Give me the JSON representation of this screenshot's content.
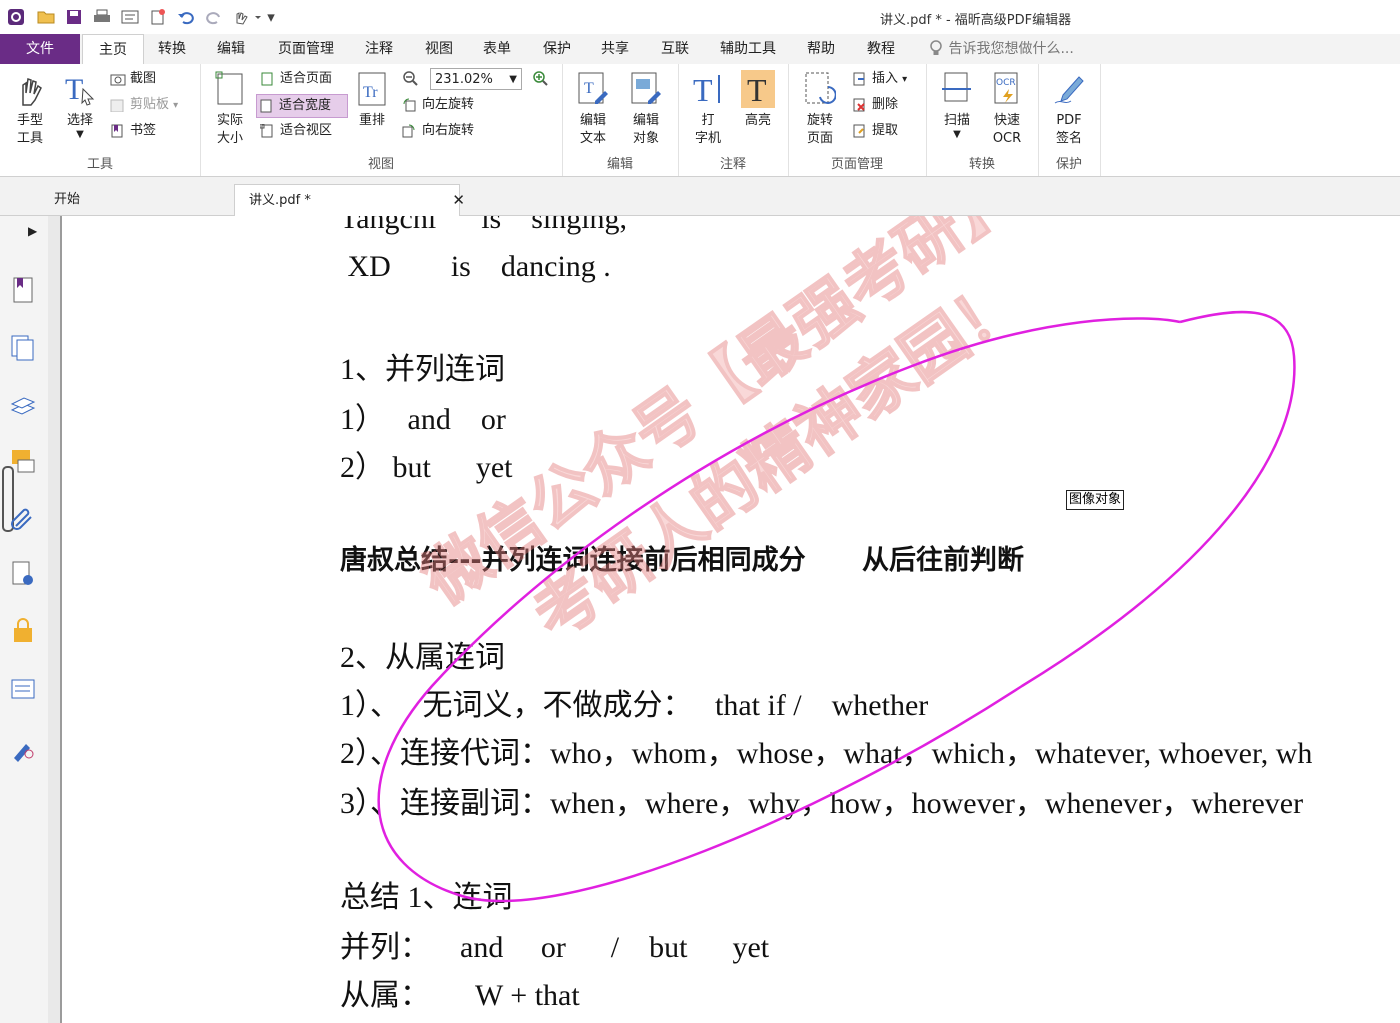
{
  "window": {
    "title": "讲义.pdf * - 福昕高级PDF编辑器"
  },
  "menu": {
    "file": "文件",
    "tabs": [
      "主页",
      "转换",
      "编辑",
      "页面管理",
      "注释",
      "视图",
      "表单",
      "保护",
      "共享",
      "互联",
      "辅助工具",
      "帮助",
      "教程"
    ],
    "tell_me": "告诉我您想做什么..."
  },
  "ribbon": {
    "tools": {
      "hand": "手型\n工具",
      "select": "选择",
      "screenshot": "截图",
      "clipboard": "剪贴板",
      "bookmark": "书签",
      "label": "工具"
    },
    "view": {
      "actual": "实际\n大小",
      "fit_page": "适合页面",
      "fit_width": "适合宽度",
      "fit_area": "适合视区",
      "reflow": "重排",
      "zoom": "231.02%",
      "rotate_left": "向左旋转",
      "rotate_right": "向右旋转",
      "label": "视图"
    },
    "edit": {
      "edit_text": "编辑\n文本",
      "edit_object": "编辑\n对象",
      "label": "编辑"
    },
    "comment": {
      "typewriter": "打\n字机",
      "highlight": "高亮",
      "label": "注释"
    },
    "pages": {
      "rotate": "旋转\n页面",
      "insert": "插入",
      "delete": "删除",
      "extract": "提取",
      "label": "页面管理"
    },
    "convert": {
      "scan": "扫描",
      "ocr": "快速\nOCR",
      "label": "转换"
    },
    "protect": {
      "sign": "PDF\n签名",
      "label": "保护"
    }
  },
  "doctabs": {
    "start": "开始",
    "file": "讲义.pdf *"
  },
  "document": {
    "lines": [
      "Tangchi      is    singing,",
      " XD        is    dancing .",
      "1、并列连词",
      "1）   and    or",
      "2） but      yet",
      "唐叔总结---并列连词连接前后相同成分      从后往前判断",
      "2、从属连词",
      "1）、   无词义，不做成分：   that if /    whether",
      "2）、连接代词：who，whom，whose，what，which，whatever, whoever, wh",
      "3）、连接副词：when，where，why，how，however，whenever，wherever",
      "总结 1、连词",
      "并列：    and     or      /    but      yet",
      "从属：      W + that"
    ],
    "image_tag": "图像对象",
    "watermark_1": "微信公众号【最强考研】",
    "watermark_2": "考研人的精神家园！",
    "ink_color": "#e020e0"
  }
}
